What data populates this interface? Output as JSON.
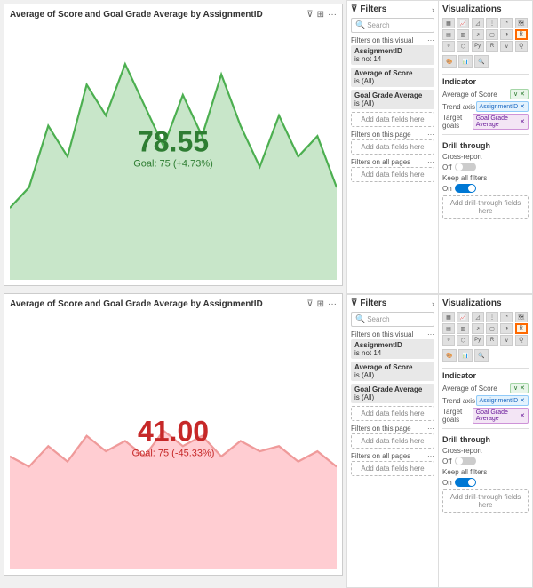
{
  "panels": [
    {
      "id": "top",
      "chart": {
        "title": "Average of Score and Goal Grade Average by AssignmentID",
        "value": "78.55",
        "goal_text": "Goal: 75 (+4.73%)",
        "value_color": "green",
        "svg_color": "#4caf50",
        "svg_bg": "#c8e6c9"
      },
      "filters": {
        "title": "Filters",
        "search_placeholder": "Search",
        "filters_on_visual_label": "Filters on this visual",
        "filter1_name": "AssignmentID",
        "filter1_value": "is not 14",
        "filter2_name": "Average of Score",
        "filter2_value": "is (All)",
        "filter3_name": "Goal Grade Average",
        "filter3_value": "is (All)",
        "add_data_label": "Add data fields here",
        "filters_on_page_label": "Filters on this page",
        "add_data_label2": "Add data fields here",
        "filters_on_all_label": "Filters on all pages",
        "add_data_label3": "Add data fields here"
      },
      "viz": {
        "title": "Visualizations",
        "indicator_label": "Indicator",
        "field1_label": "Average of Score",
        "field2_label": "Trend axis",
        "field2_value": "AssignmentID",
        "field3_label": "Target goals",
        "field3_value": "Goal Grade Average",
        "drill_title": "Drill through",
        "cross_report_label": "Cross-report",
        "cross_report_toggle": "off",
        "keep_filters_label": "Keep all filters",
        "keep_filters_toggle": "on",
        "add_drill_label": "Add drill-through fields here"
      }
    },
    {
      "id": "bottom",
      "chart": {
        "title": "Average of Score and Goal Grade Average by AssignmentID",
        "value": "41.00",
        "goal_text": "Goal: 75 (-45.33%)",
        "value_color": "red",
        "svg_color": "#ef9a9a",
        "svg_bg": "#ffcdd2"
      },
      "filters": {
        "title": "Filters",
        "search_placeholder": "Search",
        "filters_on_visual_label": "Filters on this visual",
        "filter1_name": "AssignmentID",
        "filter1_value": "is not 14",
        "filter2_name": "Average of Score",
        "filter2_value": "is (All)",
        "filter3_name": "Goal Grade Average",
        "filter3_value": "is (All)",
        "add_data_label": "Add data fields here",
        "filters_on_page_label": "Filters on this page",
        "add_data_label2": "Add data fields here",
        "filters_on_all_label": "Filters on all pages",
        "add_data_label3": "Add data fields here"
      },
      "viz": {
        "title": "Visualizations",
        "indicator_label": "Indicator",
        "field1_label": "Average of Score",
        "field2_label": "Trend axis",
        "field2_value": "AssignmentID",
        "field3_label": "Target goals",
        "field3_value": "Goal Grade Average",
        "drill_title": "Drill through",
        "cross_report_label": "Cross-report",
        "cross_report_toggle": "off",
        "keep_filters_label": "Keep all filters",
        "keep_filters_toggle": "on",
        "add_drill_label": "Add drill-through fields here"
      }
    }
  ]
}
